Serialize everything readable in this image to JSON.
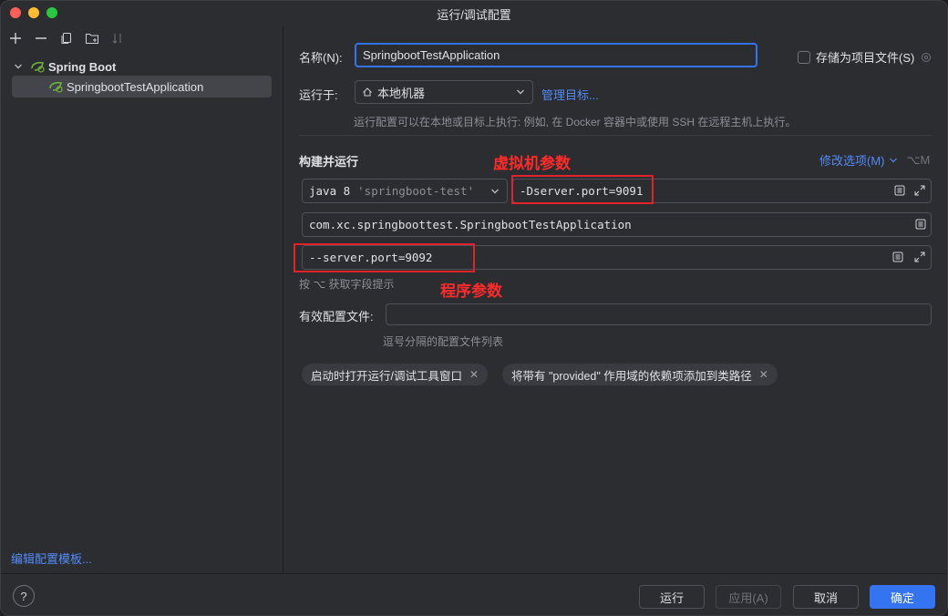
{
  "window": {
    "title": "运行/调试配置",
    "traffic_colors": [
      "#ff5f57",
      "#febc2e",
      "#28c840"
    ]
  },
  "left": {
    "toolbar_icons": [
      "add-icon",
      "remove-icon",
      "copy-icon",
      "new-folder-icon",
      "sort-icon"
    ],
    "tree": {
      "group_label": "Spring Boot",
      "item_label": "SpringbootTestApplication"
    },
    "edit_templates_link": "编辑配置模板..."
  },
  "form": {
    "name_label": "名称(N):",
    "name_value": "SpringbootTestApplication",
    "store_as_project_file": "存储为项目文件(S)",
    "run_on_label": "运行于:",
    "run_on_value": "本地机器",
    "manage_targets": "管理目标...",
    "run_on_hint": "运行配置可以在本地或目标上执行: 例如, 在 Docker 容器中或使用 SSH 在远程主机上执行。",
    "build_run_label": "构建并运行",
    "modify_options": "修改选项(M)",
    "modify_shortcut": "⌥M",
    "jdk_select": "java 8",
    "jdk_module": "'springboot-test'",
    "vm_options": "-Dserver.port=9091",
    "main_class": "com.xc.springboottest.SpringbootTestApplication",
    "program_args": "--server.port=9092",
    "field_hint": "按 ⌥ 获取字段提示",
    "active_profiles_label": "有效配置文件:",
    "active_profiles_value": "",
    "active_profiles_hint": "逗号分隔的配置文件列表",
    "chips": [
      "启动时打开运行/调试工具窗口",
      "将带有 \"provided\" 作用域的依赖项添加到类路径"
    ]
  },
  "annotations": {
    "vm_label": "虚拟机参数",
    "program_label": "程序参数",
    "color": "#e0222a"
  },
  "buttons": {
    "help": "?",
    "run": "运行",
    "apply": "应用(A)",
    "cancel": "取消",
    "ok": "确定"
  },
  "colors": {
    "accent": "#3574f0",
    "link": "#548af7",
    "spring_green": "#6db33f"
  }
}
